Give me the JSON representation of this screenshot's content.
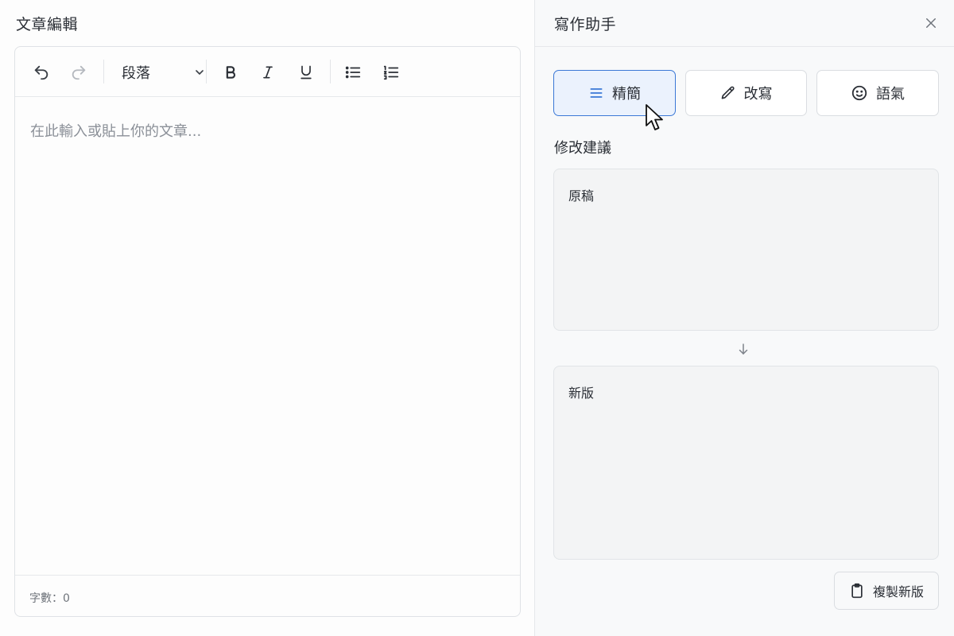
{
  "editor": {
    "title": "文章編輯",
    "toolbar": {
      "undo_icon": "undo-icon",
      "redo_icon": "redo-icon",
      "paragraph_select": "段落",
      "bold_icon": "bold-icon",
      "italic_icon": "italic-icon",
      "underline_icon": "underline-icon",
      "bullet_list_icon": "bullet-list-icon",
      "numbered_list_icon": "numbered-list-icon"
    },
    "placeholder": "在此輸入或貼上你的文章...",
    "word_count": "字數：0"
  },
  "assistant": {
    "title": "寫作助手",
    "actions": [
      {
        "label": "精簡",
        "icon": "lines-icon",
        "active": true
      },
      {
        "label": "改寫",
        "icon": "pencil-icon",
        "active": false
      },
      {
        "label": "語氣",
        "icon": "smiley-icon",
        "active": false
      }
    ],
    "suggestions_label": "修改建議",
    "original_label": "原稿",
    "new_label": "新版",
    "copy_button": "複製新版"
  },
  "colors": {
    "accent": "#3b78d6",
    "active_bg": "#ebf2fd",
    "text": "#2b2f36",
    "muted": "#8b9098"
  }
}
